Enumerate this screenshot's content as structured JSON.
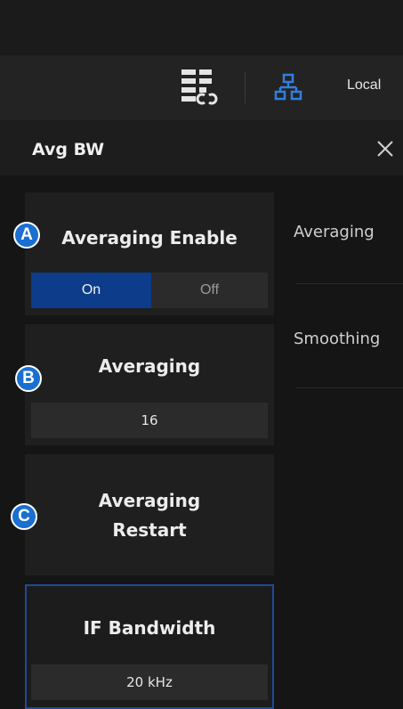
{
  "toolbar": {
    "status_text": "Local"
  },
  "panel": {
    "title": "Avg BW"
  },
  "averaging_enable": {
    "label": "Averaging Enable",
    "on_label": "On",
    "off_label": "Off",
    "selected": "On"
  },
  "averaging": {
    "label": "Averaging",
    "value": "16"
  },
  "averaging_restart": {
    "label_line1": "Averaging",
    "label_line2": "Restart"
  },
  "if_bandwidth": {
    "label": "IF Bandwidth",
    "value": "20 kHz"
  },
  "right_menu": {
    "items": [
      "Averaging",
      "Smoothing"
    ]
  },
  "callouts": [
    "A",
    "B",
    "C"
  ],
  "colors": {
    "accent": "#0c3c8a",
    "badge": "#1a6fd1",
    "active_border": "#1f4a96",
    "network_icon": "#2f7fe0"
  },
  "icons": {
    "settings_link": "list-link-icon",
    "network": "network-icon",
    "close": "close-icon"
  }
}
